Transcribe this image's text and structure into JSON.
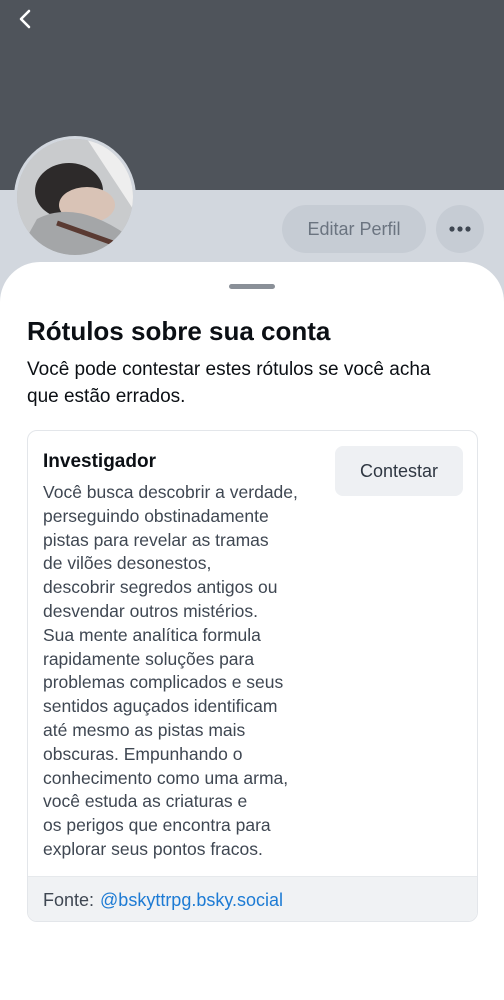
{
  "header": {
    "back_icon": "chevron-left-icon"
  },
  "profile": {
    "edit_button_label": "Editar Perfil",
    "more_icon": "ellipsis-icon"
  },
  "sheet": {
    "title": "Rótulos sobre sua conta",
    "subtitle": "Você pode contestar estes rótulos se você acha que estão errados.",
    "label": {
      "name": "Investigador",
      "description_lines": [
        "Você busca descobrir a verdade,",
        "perseguindo obstinadamente",
        "pistas para revelar as tramas",
        "de vilões desonestos,",
        "descobrir segredos antigos ou",
        "desvendar outros mistérios.",
        "Sua mente analítica formula",
        "rapidamente soluções para",
        "problemas complicados e seus",
        "sentidos aguçados identificam",
        "até mesmo as pistas mais",
        "obscuras. Empunhando o",
        "conhecimento como uma arma,",
        "você estuda as criaturas e",
        "os perigos que encontra para",
        "explorar seus pontos fracos."
      ],
      "appeal_button_label": "Contestar",
      "source_prefix": "Fonte:",
      "source_handle": "@bskyttrpg.bsky.social"
    }
  },
  "colors": {
    "banner": "#4f545b",
    "link": "#1d7bd4",
    "sheet_background": "#ffffff"
  }
}
